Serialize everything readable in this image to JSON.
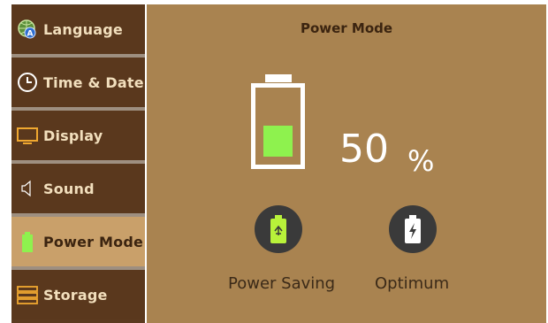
{
  "sidebar": {
    "items": [
      {
        "label": "Language",
        "icon": "globe-icon"
      },
      {
        "label": "Time & Date",
        "icon": "clock-icon"
      },
      {
        "label": "Display",
        "icon": "monitor-icon"
      },
      {
        "label": "Sound",
        "icon": "speaker-icon"
      },
      {
        "label": "Power Mode",
        "icon": "battery-icon"
      },
      {
        "label": "Storage",
        "icon": "storage-icon"
      }
    ],
    "active_index": 4
  },
  "main": {
    "title": "Power Mode",
    "battery_level": 0.5,
    "percent_value": "50",
    "percent_unit": "%",
    "modes": [
      {
        "label": "Power Saving",
        "icon": "eco-battery-icon"
      },
      {
        "label": "Optimum",
        "icon": "charging-battery-icon"
      }
    ]
  },
  "colors": {
    "sidebar_bg": "#5a381d",
    "sidebar_active_bg": "#c9a06a",
    "main_bg": "#a98350",
    "battery_fill": "#8ef24e",
    "accent_green": "#b8f23a"
  }
}
